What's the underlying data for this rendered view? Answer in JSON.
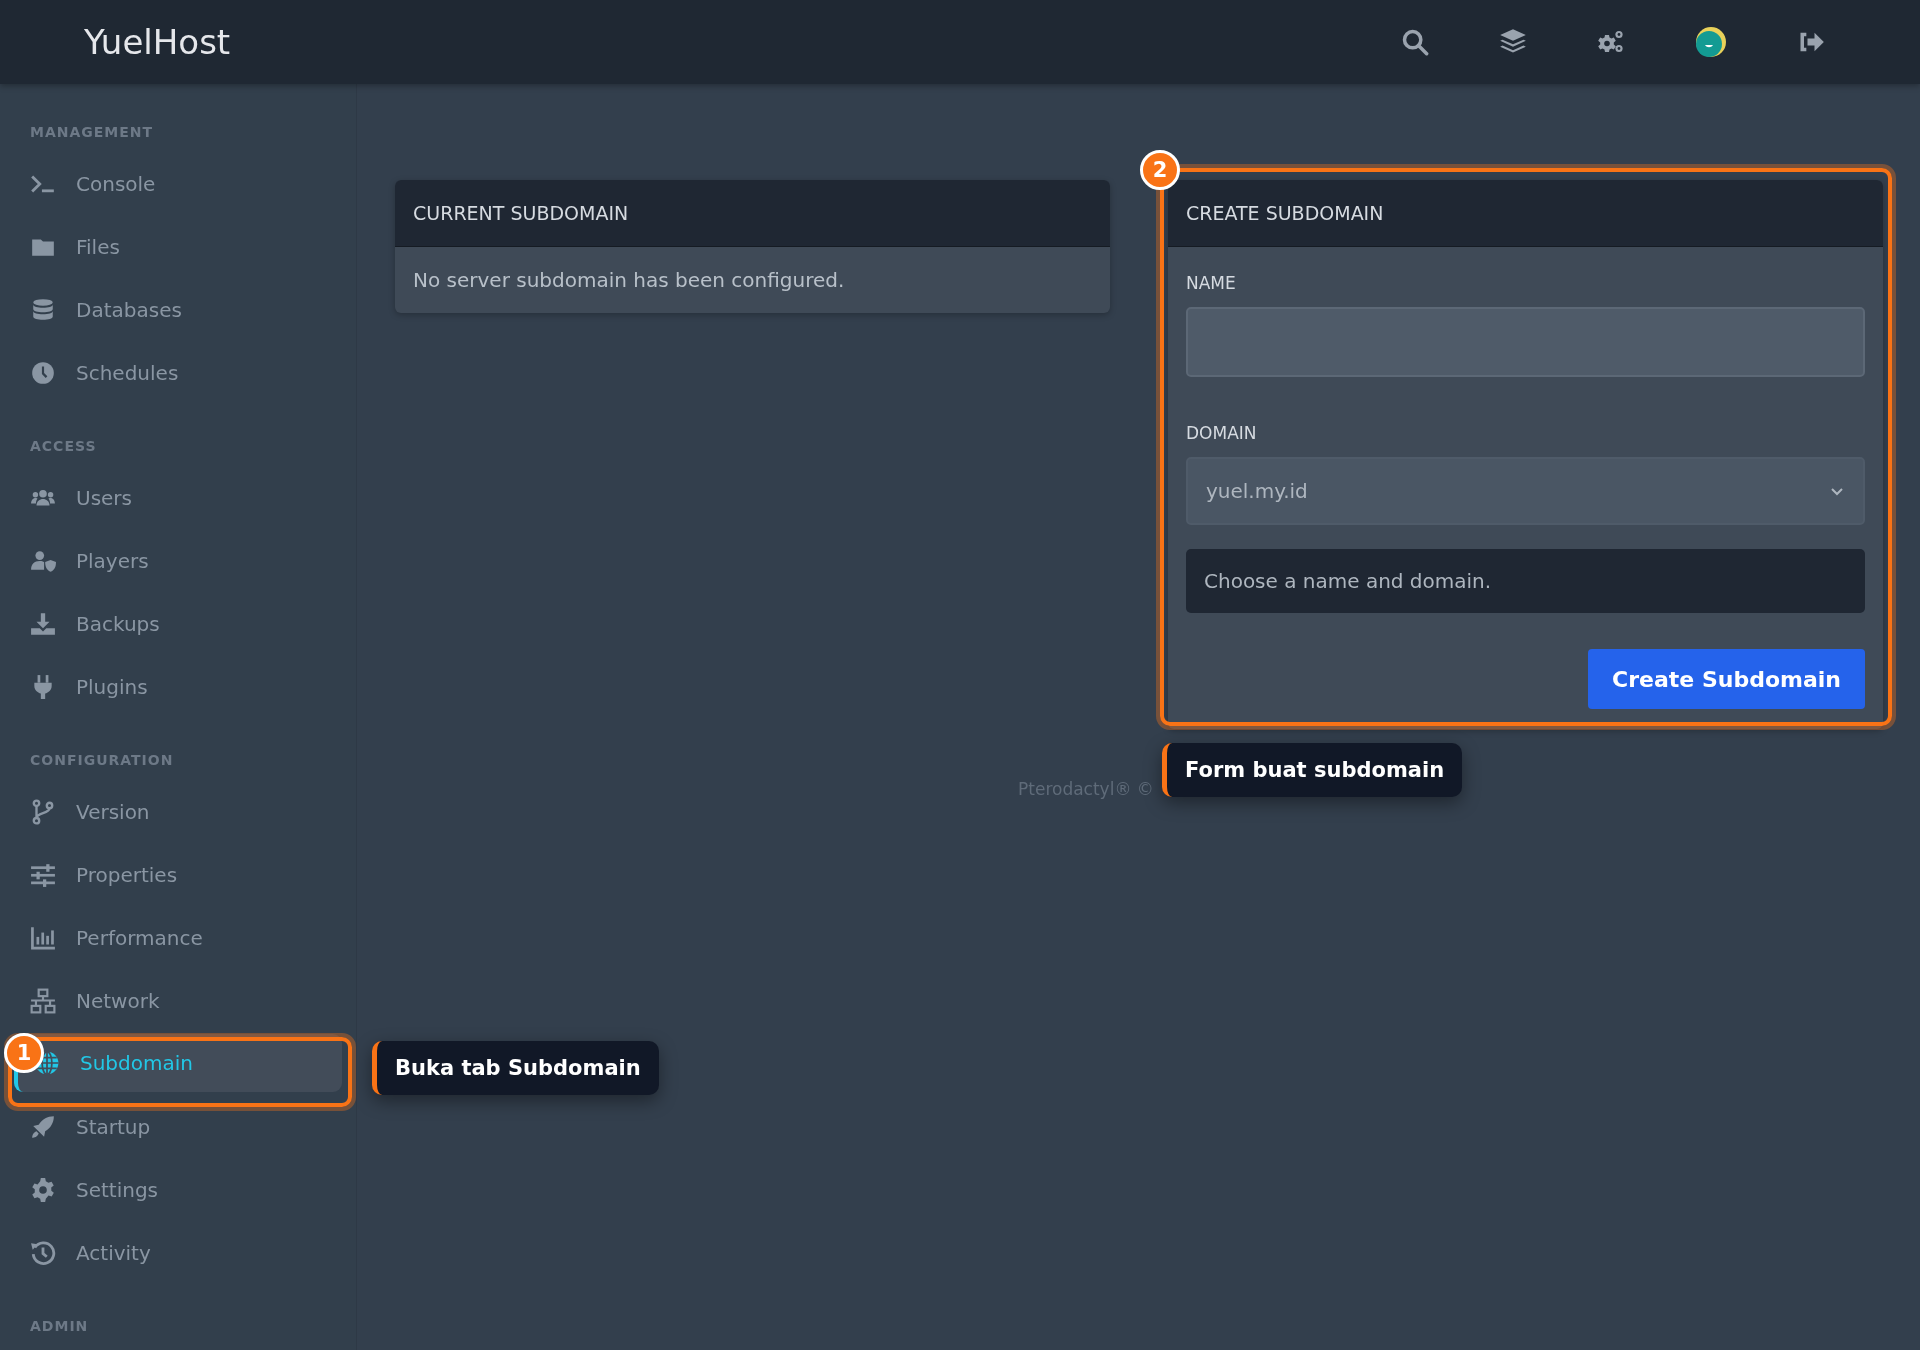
{
  "topbar": {
    "brand": "YuelHost"
  },
  "sidebar": {
    "sections": [
      {
        "heading": "MANAGEMENT",
        "items": [
          {
            "label": "Console",
            "selected": false
          },
          {
            "label": "Files",
            "selected": false
          },
          {
            "label": "Databases",
            "selected": false
          },
          {
            "label": "Schedules",
            "selected": false
          }
        ]
      },
      {
        "heading": "ACCESS",
        "items": [
          {
            "label": "Users",
            "selected": false
          },
          {
            "label": "Players",
            "selected": false
          },
          {
            "label": "Backups",
            "selected": false
          },
          {
            "label": "Plugins",
            "selected": false
          }
        ]
      },
      {
        "heading": "CONFIGURATION",
        "items": [
          {
            "label": "Version",
            "selected": false
          },
          {
            "label": "Properties",
            "selected": false
          },
          {
            "label": "Performance",
            "selected": false
          },
          {
            "label": "Network",
            "selected": false
          },
          {
            "label": "Subdomain",
            "selected": true
          },
          {
            "label": "Startup",
            "selected": false
          },
          {
            "label": "Settings",
            "selected": false
          },
          {
            "label": "Activity",
            "selected": false
          }
        ]
      },
      {
        "heading": "ADMIN"
      }
    ]
  },
  "current_subdomain": {
    "title": "CURRENT SUBDOMAIN",
    "message": "No server subdomain has been configured."
  },
  "create_subdomain": {
    "title": "CREATE SUBDOMAIN",
    "name_field": {
      "label": "NAME"
    },
    "domain_field": {
      "label": "DOMAIN",
      "value": "yuel.my.id"
    },
    "notice": "Choose a name and domain.",
    "submit_button": "Create Subdomain"
  },
  "footer": "Pterodactyl® ©",
  "annotations": [
    {
      "number": "1",
      "text": "Buka tab Subdomain"
    },
    {
      "number": "2",
      "text": "Form buat subdomain"
    }
  ]
}
